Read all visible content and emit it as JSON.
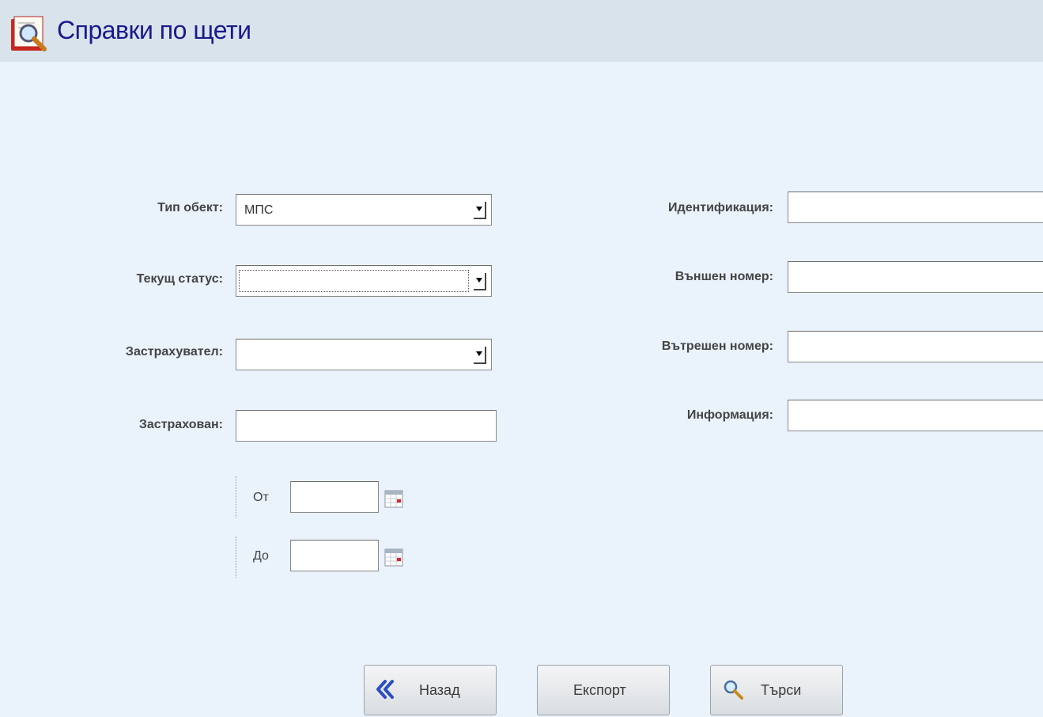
{
  "page": {
    "title": "Справки по щети",
    "title_icon": "book-search-icon"
  },
  "form": {
    "tip_obekt": {
      "label": "Тип обект:",
      "value": "МПС"
    },
    "tekusht_status": {
      "label": "Текущ статус:",
      "value": ""
    },
    "zastrahovatel": {
      "label": "Застрахувател:",
      "value": ""
    },
    "zastrahovan": {
      "label": "Застрахован:",
      "value": ""
    },
    "identifikacia": {
      "label": "Идентификация:",
      "value": ""
    },
    "vanshen_nomer": {
      "label": "Външен номер:",
      "value": ""
    },
    "vatreshen_nomer": {
      "label": "Вътрешен номер:",
      "value": ""
    },
    "informacia": {
      "label": "Информация:",
      "value": ""
    },
    "date_from": {
      "label": "От",
      "value": "",
      "icon": "calendar-icon"
    },
    "date_to": {
      "label": "До",
      "value": "",
      "icon": "calendar-icon"
    }
  },
  "buttons": {
    "back": {
      "label": "Назад",
      "icon": "double-chevron-left-icon"
    },
    "export": {
      "label": "Експорт"
    },
    "search": {
      "label": "Търси",
      "icon": "magnifier-icon"
    }
  },
  "colors": {
    "title": "#1a1a8c",
    "header_bg": "#d8e3ec",
    "page_bg": "#eaf2fb",
    "back_icon": "#2b4fc4"
  }
}
